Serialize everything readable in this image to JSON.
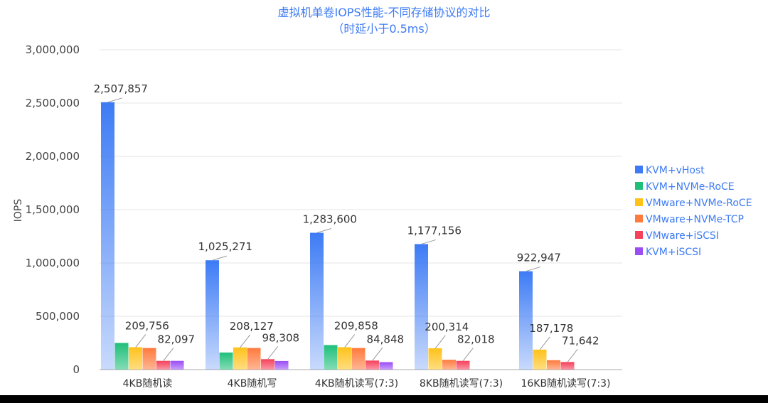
{
  "chart_data": {
    "type": "bar",
    "title": "虚拟机单卷IOPS性能-不同存储协议的对比",
    "subtitle": "（时延小于0.5ms）",
    "xlabel": "",
    "ylabel": "IOPS",
    "ylim": [
      0,
      3000000
    ],
    "yticks": [
      0,
      500000,
      1000000,
      1500000,
      2000000,
      2500000,
      3000000
    ],
    "ytick_labels": [
      "0",
      "500,000",
      "1,000,000",
      "1,500,000",
      "2,000,000",
      "2,500,000",
      "3,000,000"
    ],
    "grid": true,
    "legend_position": "right",
    "categories": [
      "4KB随机读",
      "4KB随机写",
      "4KB随机读写(7:3)",
      "8KB随机读写(7:3)",
      "16KB随机读写(7:3)"
    ],
    "series": [
      {
        "name": "KVM+vHost",
        "color": "#3d7bf5",
        "values": [
          2507857,
          1025271,
          1283600,
          1177156,
          922947
        ]
      },
      {
        "name": "KVM+NVMe-RoCE",
        "color": "#1fbf7a",
        "values": [
          250000,
          160000,
          230000,
          null,
          null
        ]
      },
      {
        "name": "VMware+NVMe-RoCE",
        "color": "#ffc21a",
        "values": [
          209756,
          208127,
          209858,
          200314,
          187178
        ]
      },
      {
        "name": "VMware+NVMe-TCP",
        "color": "#ff7a3d",
        "values": [
          203000,
          203000,
          203000,
          92000,
          88000
        ]
      },
      {
        "name": "VMware+iSCSI",
        "color": "#f5415a",
        "values": [
          82097,
          98308,
          84848,
          82018,
          71642
        ]
      },
      {
        "name": "KVM+iSCSI",
        "color": "#9b4df5",
        "values": [
          82000,
          81000,
          70000,
          null,
          null
        ]
      }
    ],
    "data_labels": [
      {
        "category": 0,
        "series": 0,
        "text": "2,507,857"
      },
      {
        "category": 0,
        "series": 2,
        "text": "209,756"
      },
      {
        "category": 0,
        "series": 4,
        "text": "82,097"
      },
      {
        "category": 1,
        "series": 0,
        "text": "1,025,271"
      },
      {
        "category": 1,
        "series": 2,
        "text": "208,127"
      },
      {
        "category": 1,
        "series": 4,
        "text": "98,308"
      },
      {
        "category": 2,
        "series": 0,
        "text": "1,283,600"
      },
      {
        "category": 2,
        "series": 2,
        "text": "209,858"
      },
      {
        "category": 2,
        "series": 4,
        "text": "84,848"
      },
      {
        "category": 3,
        "series": 0,
        "text": "1,177,156"
      },
      {
        "category": 3,
        "series": 2,
        "text": "200,314"
      },
      {
        "category": 3,
        "series": 4,
        "text": "82,018"
      },
      {
        "category": 4,
        "series": 0,
        "text": "922,947"
      },
      {
        "category": 4,
        "series": 2,
        "text": "187,178"
      },
      {
        "category": 4,
        "series": 4,
        "text": "71,642"
      }
    ]
  }
}
